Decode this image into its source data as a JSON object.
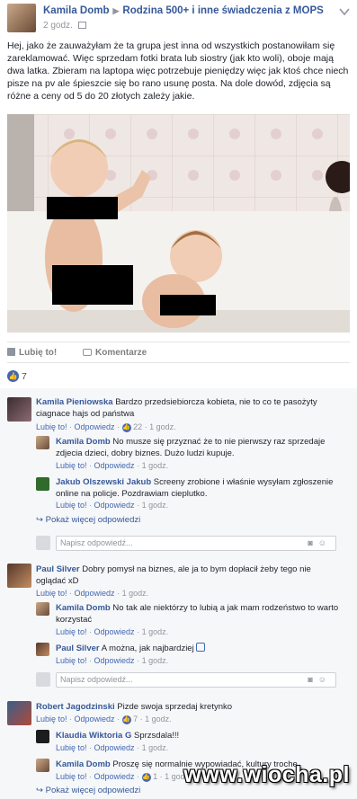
{
  "post": {
    "author": "Kamila Domb",
    "separator": "▶",
    "group": "Rodzina 500+ i inne świadczenia z MOPS",
    "time": "2 godz.",
    "text": "Hej, jako że zauważyłam że ta grupa jest inna od wszystkich postanowiłam się zareklamować. Więc sprzedam fotki brata lub siostry (jak kto woli), oboje mają dwa latka. Zbieram na laptopa więc potrzebuje pieniędzy więc jak ktoś chce niech pisze na pv ale śpieszcie się bo rano usunę posta. Na dole dowód, zdjęcia są różne a ceny od 5 do 20 złotych zależy jakie."
  },
  "actions": {
    "like": "Lubię to!",
    "comment": "Komentarze"
  },
  "likes": {
    "count": "7"
  },
  "comments": [
    {
      "author": "Kamila Pieniowska",
      "text": "Bardzo przedsiebiorcza kobieta, nie to co te pasożyty ciagnace hajs od państwa",
      "like": "Lubię to!",
      "reply": "Odpowiedz",
      "reactions": "22",
      "time": "1 godz."
    },
    {
      "author": "Kamila Domb",
      "text": "No musze się przyznać że to nie pierwszy raz sprzedaje zdjecia dzieci, dobry biznes. Dużo ludzi kupuje.",
      "like": "Lubię to!",
      "reply": "Odpowiedz",
      "time": "1 godz."
    },
    {
      "author": "Jakub Olszewski Jakub",
      "text": "Screeny zrobione i właśnie wysyłam zgłoszenie online na policje. Pozdrawiam cieplutko.",
      "like": "Lubię to!",
      "reply": "Odpowiedz",
      "time": "1 godz."
    },
    {
      "author": "Paul Silver",
      "text": "Dobry pomysł na biznes, ale ja to bym dopłacił żeby tego nie oglądać xD",
      "like": "Lubię to!",
      "reply": "Odpowiedz",
      "time": "1 godz."
    },
    {
      "author": "Kamila Domb",
      "text": "No tak ale niektórzy to lubią a jak mam rodzeństwo to warto korzystać",
      "like": "Lubię to!",
      "reply": "Odpowiedz",
      "time": "1 godz."
    },
    {
      "author": "Paul Silver",
      "text": "A można, jak najbardziej",
      "like": "Lubię to!",
      "reply": "Odpowiedz",
      "time": "1 godz."
    },
    {
      "author": "Robert Jagodzinski",
      "text": "Pizde swoja sprzedaj kretynko",
      "like": "Lubię to!",
      "reply": "Odpowiedz",
      "reactions": "7",
      "time": "1 godz."
    },
    {
      "author": "Klaudia Wiktoria G",
      "text": "Sprzsdala!!!",
      "like": "Lubię to!",
      "reply": "Odpowiedz",
      "time": "1 godz."
    },
    {
      "author": "Kamila Domb",
      "text": "Proszę się normalnie wypowiadać, kultury troche.",
      "like": "Lubię to!",
      "reply": "Odpowiedz",
      "reactions": "1",
      "time": "1 godz."
    }
  ],
  "more_replies": "Pokaż więcej odpowiedzi",
  "reply_placeholder": "Napisz odpowiedź...",
  "watermark": "www.wiocha.pl"
}
